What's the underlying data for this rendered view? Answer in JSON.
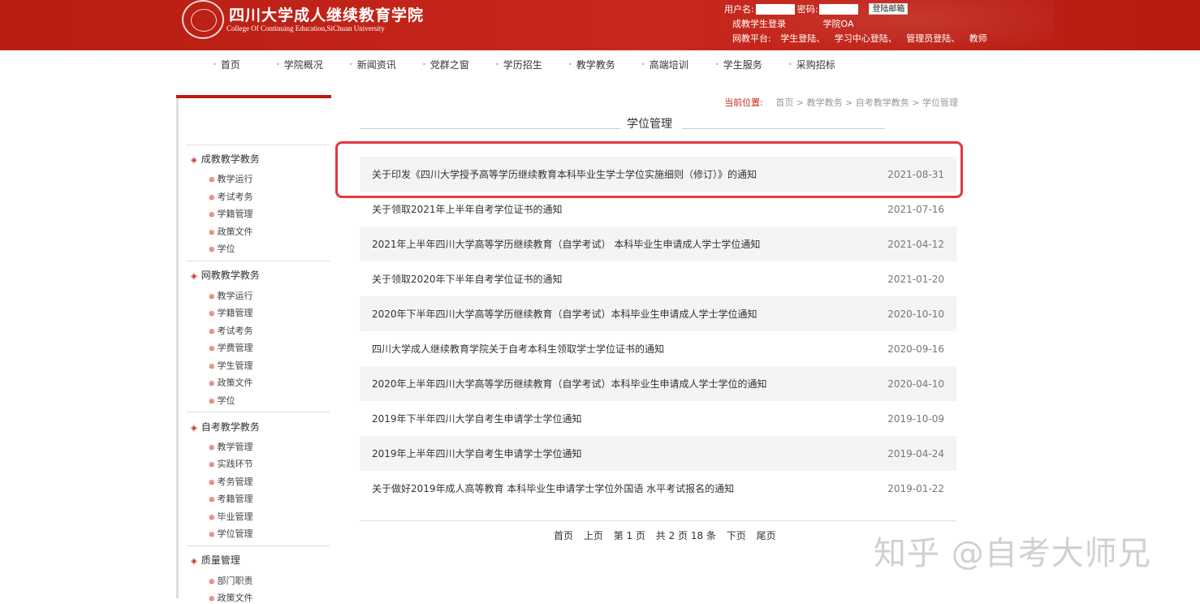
{
  "header": {
    "logo_cn": "四川大学成人继续教育学院",
    "logo_en": "College Of Continuing Education,SiChuan University",
    "username_label": "用户名:",
    "password_label": "密码:",
    "login_button": "登陆邮箱",
    "links_row1": [
      "成教学生登录",
      "学院OA"
    ],
    "links_row2": [
      "网教平台:",
      "学生登陆、",
      "学习中心登陆、",
      "管理员登陆、",
      "教师"
    ]
  },
  "nav": {
    "items": [
      "首页",
      "学院概况",
      "新闻资讯",
      "党群之窗",
      "学历招生",
      "教学教务",
      "高端培训",
      "学生服务",
      "采购招标"
    ]
  },
  "sidebar": {
    "sections": [
      {
        "title": "成教教学教务",
        "items": [
          "教学运行",
          "考试考务",
          "学籍管理",
          "政策文件",
          "学位"
        ]
      },
      {
        "title": "网教教学教务",
        "items": [
          "教学运行",
          "学籍管理",
          "考试考务",
          "学费管理",
          "学生管理",
          "政策文件",
          "学位"
        ]
      },
      {
        "title": "自考教学教务",
        "items": [
          "教学管理",
          "实践环节",
          "考务管理",
          "考籍管理",
          "毕业管理",
          "学位管理"
        ]
      },
      {
        "title": "质量管理",
        "items": [
          "部门职责",
          "政策文件"
        ]
      }
    ]
  },
  "breadcrumb": {
    "label": "当前位置:",
    "path": "首页 > 教学教务 > 自考教学教务 > 学位管理"
  },
  "page_title": "学位管理",
  "news": [
    {
      "title": "关于印发《四川大学授予高等学历继续教育本科毕业生学士学位实施细则（修订）》的通知",
      "date": "2021-08-31"
    },
    {
      "title": "关于领取2021年上半年自考学位证书的通知",
      "date": "2021-07-16"
    },
    {
      "title": "2021年上半年四川大学高等学历继续教育（自学考试） 本科毕业生申请成人学士学位通知",
      "date": "2021-04-12"
    },
    {
      "title": "关于领取2020年下半年自考学位证书的通知",
      "date": "2021-01-20"
    },
    {
      "title": "2020年下半年四川大学高等学历继续教育（自学考试）本科毕业生申请成人学士学位通知",
      "date": "2020-10-10"
    },
    {
      "title": "四川大学成人继续教育学院关于自考本科生领取学士学位证书的通知",
      "date": "2020-09-16"
    },
    {
      "title": "2020年上半年四川大学高等学历继续教育（自学考试）本科毕业生申请成人学士学位的通知",
      "date": "2020-04-10"
    },
    {
      "title": "2019年下半年四川大学自考生申请学士学位通知",
      "date": "2019-10-09"
    },
    {
      "title": "2019年上半年四川大学自考生申请学士学位通知",
      "date": "2019-04-24"
    },
    {
      "title": "关于做好2019年成人高等教育 本科毕业生申请学士学位外国语 水平考试报名的通知",
      "date": "2019-01-22"
    }
  ],
  "pager": {
    "first": "首页",
    "prev": "上页",
    "current": "第 1 页",
    "total": "共 2 页 18 条",
    "next": "下页",
    "last": "尾页"
  },
  "watermark": "知乎 @自考大师兄"
}
